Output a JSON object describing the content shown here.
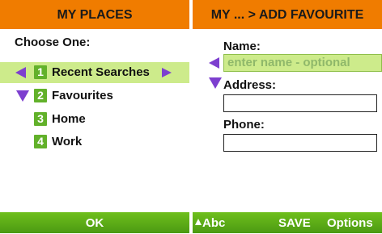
{
  "left": {
    "title": "MY PLACES",
    "heading": "Choose One:",
    "items": [
      {
        "num": "1",
        "label": "Recent Searches",
        "selected": true
      },
      {
        "num": "2",
        "label": "Favourites",
        "selected": false
      },
      {
        "num": "3",
        "label": "Home",
        "selected": false
      },
      {
        "num": "4",
        "label": "Work",
        "selected": false
      }
    ],
    "softkey_center": "OK"
  },
  "right": {
    "title": "MY ... > ADD FAVOURITE",
    "fields": {
      "name_label": "Name:",
      "name_placeholder": "enter name - optional",
      "address_label": "Address:",
      "phone_label": "Phone:"
    },
    "softkeys": {
      "left": "Abc",
      "center": "SAVE",
      "right": "Options"
    }
  },
  "colors": {
    "title_bar": "#f07c00",
    "softkey_bar": "#5aaa17",
    "highlight": "#cdeb8b",
    "arrow": "#7d3fcf",
    "number_badge": "#62b12a"
  }
}
